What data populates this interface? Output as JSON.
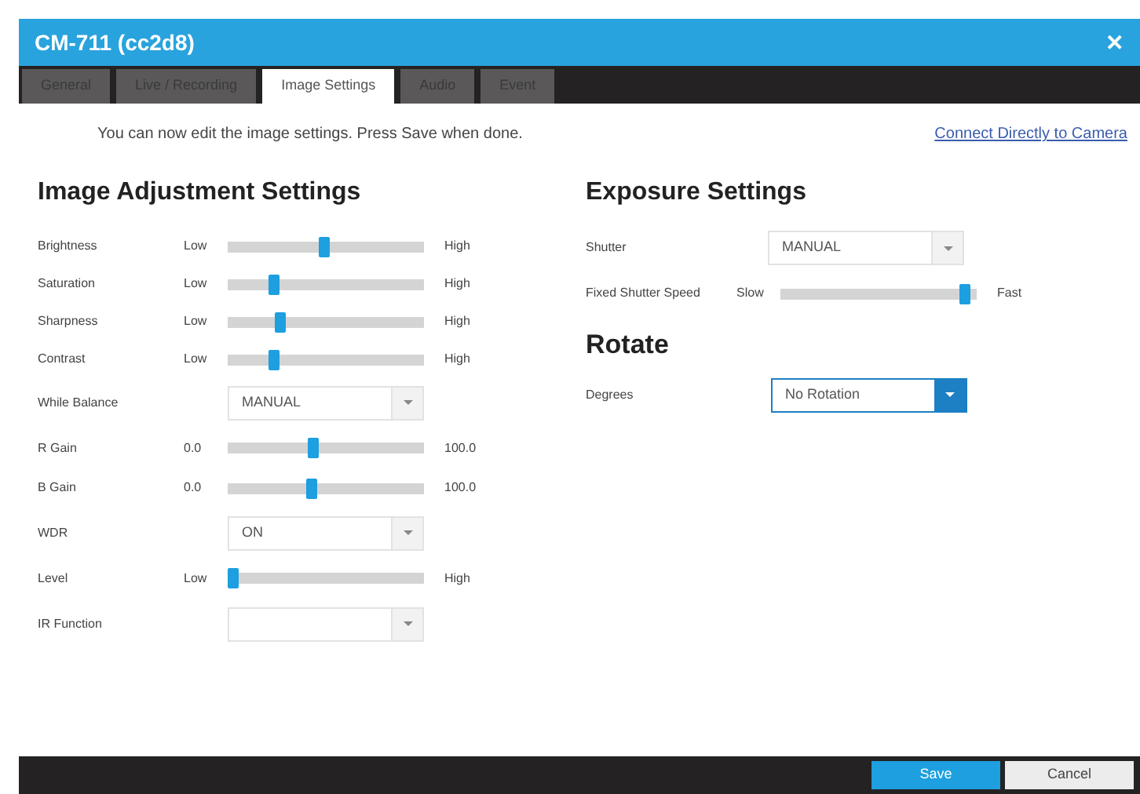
{
  "window": {
    "title": "CM-711 (cc2d8)",
    "close": "✕"
  },
  "tabs": [
    {
      "label": "General",
      "selected": false
    },
    {
      "label": "Live / Recording",
      "selected": false
    },
    {
      "label": "Image Settings",
      "selected": true
    },
    {
      "label": "Audio",
      "selected": false
    },
    {
      "label": "Event",
      "selected": false
    }
  ],
  "notice": "You can now edit the image settings. Press Save when done.",
  "connect_link": "Connect Directly to Camera",
  "image_adjustment": {
    "heading": "Image Adjustment Settings",
    "rows": [
      {
        "kind": "slider",
        "label": "Brightness",
        "min_label": "Low",
        "max_label": "High",
        "level": 0.49
      },
      {
        "kind": "slider",
        "label": "Saturation",
        "min_label": "Low",
        "max_label": "High",
        "level": 0.22
      },
      {
        "kind": "slider",
        "label": "Sharpness",
        "min_label": "Low",
        "max_label": "High",
        "level": 0.25
      },
      {
        "kind": "slider",
        "label": "Contrast",
        "min_label": "Low",
        "max_label": "High",
        "level": 0.22
      },
      {
        "kind": "select",
        "label": "While Balance",
        "value": "MANUAL",
        "active": false
      },
      {
        "kind": "slider",
        "label": "R Gain",
        "min_label": "0.0",
        "max_label": "100.0",
        "level": 0.43
      },
      {
        "kind": "slider",
        "label": "B Gain",
        "min_label": "0.0",
        "max_label": "100.0",
        "level": 0.42
      },
      {
        "kind": "select",
        "label": "WDR",
        "value": "ON",
        "active": false
      },
      {
        "kind": "slider",
        "label": "Level",
        "min_label": "Low",
        "max_label": "High",
        "level": 0
      },
      {
        "kind": "select",
        "label": "IR Function",
        "active": false
      }
    ]
  },
  "exposure": {
    "heading": "Exposure Settings",
    "rows": [
      {
        "kind": "select",
        "label": "Shutter",
        "value": "MANUAL",
        "active": false
      },
      {
        "kind": "slider",
        "label": "Fixed Shutter Speed",
        "min_label": "Slow",
        "max_label": "Fast",
        "level": 0.97
      }
    ]
  },
  "rotate": {
    "heading": "Rotate",
    "rows": [
      {
        "kind": "select",
        "label": "Degrees",
        "value": "No Rotation",
        "active": true
      }
    ]
  },
  "buttons": [
    {
      "label": "Save",
      "primary": true
    },
    {
      "label": "Cancel",
      "primary": false
    }
  ]
}
